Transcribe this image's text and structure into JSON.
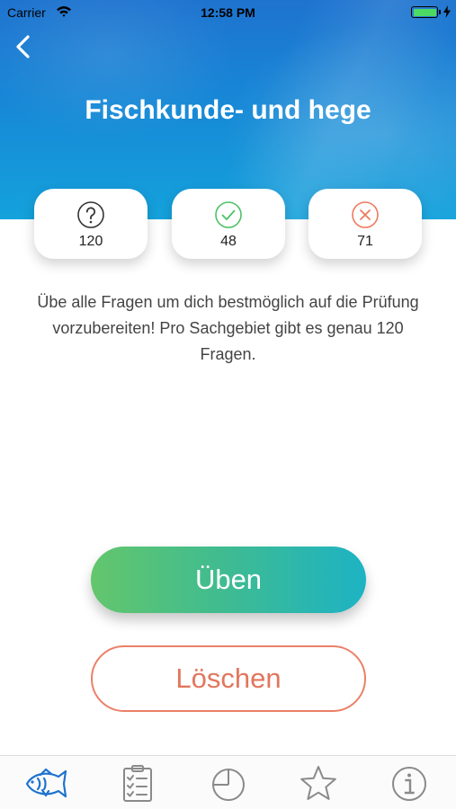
{
  "status_bar": {
    "carrier": "Carrier",
    "time": "12:58 PM",
    "battery_level": 1.0
  },
  "header": {
    "back_icon": "chevron-left-icon",
    "title": "Fischkunde- und hege"
  },
  "stats": [
    {
      "icon": "question-circle-icon",
      "value": "120",
      "color": "#333333"
    },
    {
      "icon": "check-circle-icon",
      "value": "48",
      "color": "#4cc266"
    },
    {
      "icon": "x-circle-icon",
      "value": "71",
      "color": "#ee7a5c"
    }
  ],
  "description": "Übe alle Fragen um dich bestmöglich auf die Prüfung vorzubereiten! Pro Sachgebiet gibt es genau 120 Fragen.",
  "actions": {
    "practice_label": "Üben",
    "delete_label": "Löschen"
  },
  "colors": {
    "header_gradient_top": "#1e73cf",
    "header_gradient_bottom": "#14a2dc",
    "practice_gradient_start": "#63c66c",
    "practice_gradient_end": "#1db3c4",
    "delete_accent": "#e2765d",
    "tab_active": "#1e73cf",
    "tab_inactive": "#8a8a8a"
  },
  "tab_bar": {
    "active_index": 0,
    "items": [
      {
        "icon": "fish-icon"
      },
      {
        "icon": "checklist-icon"
      },
      {
        "icon": "pie-chart-icon"
      },
      {
        "icon": "star-icon"
      },
      {
        "icon": "info-icon"
      }
    ]
  }
}
